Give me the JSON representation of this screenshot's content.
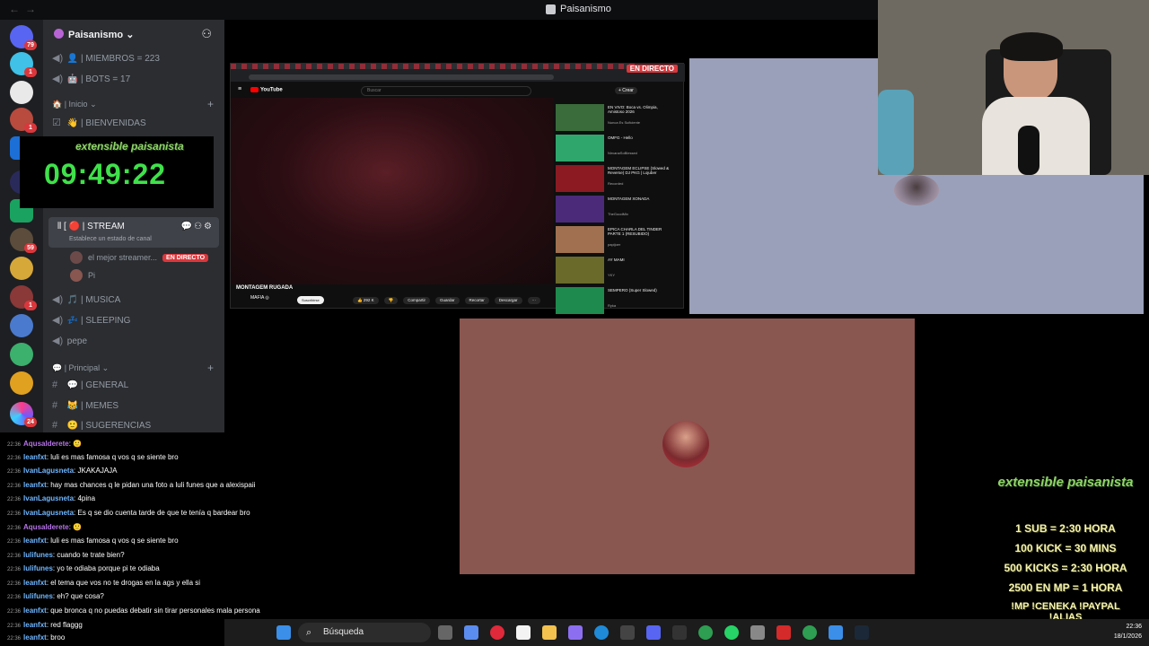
{
  "window": {
    "title": "Paisanismo"
  },
  "server": {
    "name": "Paisanismo"
  },
  "server_badges": [
    "79",
    "1",
    "1",
    "59",
    "1",
    "24"
  ],
  "channels": {
    "members": "| MIEMBROS = 223",
    "bots": "| BOTS = 17",
    "cat_inicio": "| Inicio",
    "bienvenidas": "| BIENVENIDAS",
    "stream": "| STREAM",
    "stream_status": "Establece un estado de canal",
    "voice_members": [
      {
        "name": "el mejor streamer...",
        "badge": "EN DIRECTO"
      },
      {
        "name": "Pi",
        "badge": ""
      }
    ],
    "musica": "| MUSICA",
    "sleeping": "| SLEEPING",
    "pepe": "pepe",
    "cat_principal": "| Principal",
    "general": "| GENERAL",
    "memes": "| MEMES",
    "sugerencias": "| SUGERENCIAS"
  },
  "timer": {
    "logo": "extensible paisanista",
    "value": "09:49:22"
  },
  "chat": [
    {
      "user": "Aqusalderete",
      "text": ": 🙂",
      "color": "#b673e8"
    },
    {
      "user": "leanfxt",
      "text": ": luli es mas famosa q vos q se siente bro",
      "color": "#6fb6ff"
    },
    {
      "user": "IvanLagusneta",
      "text": ": JKAKAJAJA",
      "color": "#6fb6ff"
    },
    {
      "user": "leanfxt",
      "text": ": hay mas chances q le pidan una foto a luli funes que a alexispaii",
      "color": "#6fb6ff"
    },
    {
      "user": "IvanLagusneta",
      "text": ": 4pina",
      "color": "#6fb6ff"
    },
    {
      "user": "IvanLagusneta",
      "text": ": Es q se dio cuenta tarde de que te tenía q bardear bro",
      "color": "#6fb6ff"
    },
    {
      "user": "Aqusalderete",
      "text": ": 🙂",
      "color": "#b673e8"
    },
    {
      "user": "leanfxt",
      "text": ": luli es mas famosa q vos q se siente bro",
      "color": "#6fb6ff"
    },
    {
      "user": "lulifunes",
      "text": ": cuando te trate bien?",
      "color": "#6fb6ff"
    },
    {
      "user": "lulifunes",
      "text": ": yo te odiaba porque pi te odiaba",
      "color": "#6fb6ff"
    },
    {
      "user": "leanfxt",
      "text": ": el tema que vos no te drogas en la ags y ella si",
      "color": "#6fb6ff"
    },
    {
      "user": "lulifunes",
      "text": ": eh? que cosa?",
      "color": "#6fb6ff"
    },
    {
      "user": "leanfxt",
      "text": ": que bronca q no puedas debatir sin tirar personales mala persona",
      "color": "#6fb6ff"
    },
    {
      "user": "leanfxt",
      "text": ": red flaggg",
      "color": "#6fb6ff"
    },
    {
      "user": "leanfxt",
      "text": ": broo",
      "color": "#6fb6ff"
    }
  ],
  "chat_timestamp": "22:36",
  "youtube": {
    "live_badge": "EN DIRECTO",
    "logo": "YouTube",
    "search_placeholder": "Buscar",
    "create_label": "+ Crear",
    "video_title": "MONTAGEM RUGADA",
    "channel": "MAFIA ◎",
    "subscribe": "Suscribirse",
    "actions": [
      "👍 292 K",
      "👎",
      "Compartir",
      "Guardar",
      "Recortar",
      "Descargar",
      "···"
    ],
    "recommendations": [
      {
        "title": "EN VIVO: Boca vs. Olimpia, Amistoso 2026",
        "meta": "Nunca Es Suficiente"
      },
      {
        "title": "OMFG - Hello",
        "meta": "NirvanaSoBlessed"
      },
      {
        "title": "MONTAGEM ECLIPSE (Slowed & Reverse) DJ PKG | Lojuber",
        "meta": "Recorded"
      },
      {
        "title": "MONTAGEM XONADA",
        "meta": "TheGoodMix"
      },
      {
        "title": "EPICA CHARLA DEL TINDER PARTE 1 (RESUBIDO)",
        "meta": "papijoer"
      },
      {
        "title": "AY MAMI",
        "meta": "YKY"
      },
      {
        "title": "SEMPERO (Super Slowed)",
        "meta": "Ryka"
      }
    ]
  },
  "goals": {
    "logo": "extensible paisanista",
    "lines": [
      "1 SUB = 2:30 HORA",
      "100 KICK = 30 MINS",
      "500 KICKS = 2:30 HORA",
      "2500 EN MP = 1 HORA",
      "!MP !CENEKA !PAYPAL !ALIAS"
    ]
  },
  "taskbar": {
    "search": "Búsqueda",
    "time": "22:36",
    "date": "18/1/2026"
  }
}
